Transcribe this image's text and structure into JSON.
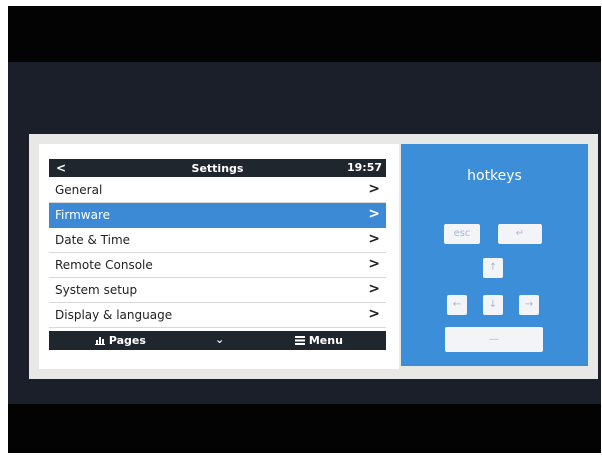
{
  "header": {
    "back": "<",
    "title": "Settings",
    "time": "19:57"
  },
  "menu": {
    "items": [
      {
        "label": "General",
        "chevron": ">"
      },
      {
        "label": "Firmware",
        "chevron": ">",
        "selected": true
      },
      {
        "label": "Date & Time",
        "chevron": ">"
      },
      {
        "label": "Remote Console",
        "chevron": ">"
      },
      {
        "label": "System setup",
        "chevron": ">"
      },
      {
        "label": "Display & language",
        "chevron": ">"
      }
    ]
  },
  "footer": {
    "pages": "Pages",
    "pages_icon": "bar-chart-icon",
    "mid": "⌄",
    "menu": "Menu",
    "menu_icon": "hamburger-icon"
  },
  "hotkeys": {
    "title": "hotkeys",
    "esc": "esc",
    "enter": "↵",
    "up": "↑",
    "left": "←",
    "down": "↓",
    "right": "→",
    "space": "—"
  },
  "colors": {
    "accent": "#3c8ad6",
    "bar": "#20262e",
    "hotkeys_bg": "#3c8ed8"
  }
}
